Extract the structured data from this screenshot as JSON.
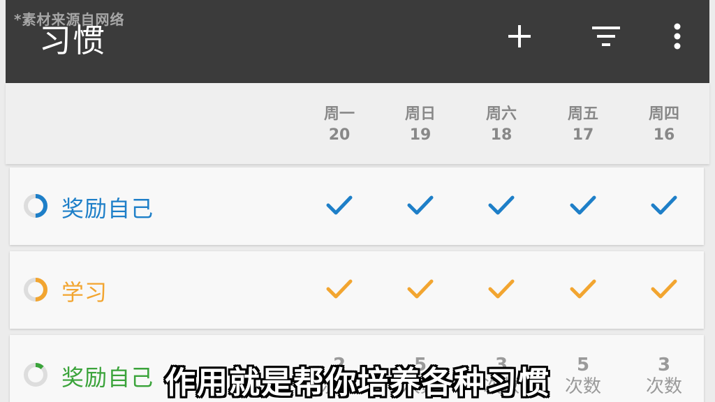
{
  "watermark": "*素材来源自网络",
  "toolbar": {
    "title": "习惯",
    "icons": [
      "plus-icon",
      "filter-icon",
      "more-vert-icon"
    ]
  },
  "header": {
    "days": [
      {
        "name": "周一",
        "num": "20"
      },
      {
        "name": "周日",
        "num": "19"
      },
      {
        "name": "周六",
        "num": "18"
      },
      {
        "name": "周五",
        "num": "17"
      },
      {
        "name": "周四",
        "num": "16"
      }
    ]
  },
  "habits": [
    {
      "name": "奖励自己",
      "color": "#1e7fc8",
      "progress": 0.5,
      "marks": [
        "check",
        "check",
        "check",
        "check",
        "check"
      ]
    },
    {
      "name": "学习",
      "color": "#f2a530",
      "progress": 0.5,
      "marks": [
        "check",
        "check",
        "check",
        "check",
        "check"
      ]
    },
    {
      "name": "奖励自己",
      "color": "#3aa33a",
      "progress": 0.12,
      "counts": [
        {
          "num": "2",
          "unit": "次数"
        },
        {
          "num": "5",
          "unit": "次数"
        },
        {
          "num": "3",
          "unit": "次数"
        },
        {
          "num": "5",
          "unit": "次数"
        },
        {
          "num": "3",
          "unit": "次数"
        }
      ]
    }
  ],
  "subtitle": "作用就是帮你培养各种习惯"
}
